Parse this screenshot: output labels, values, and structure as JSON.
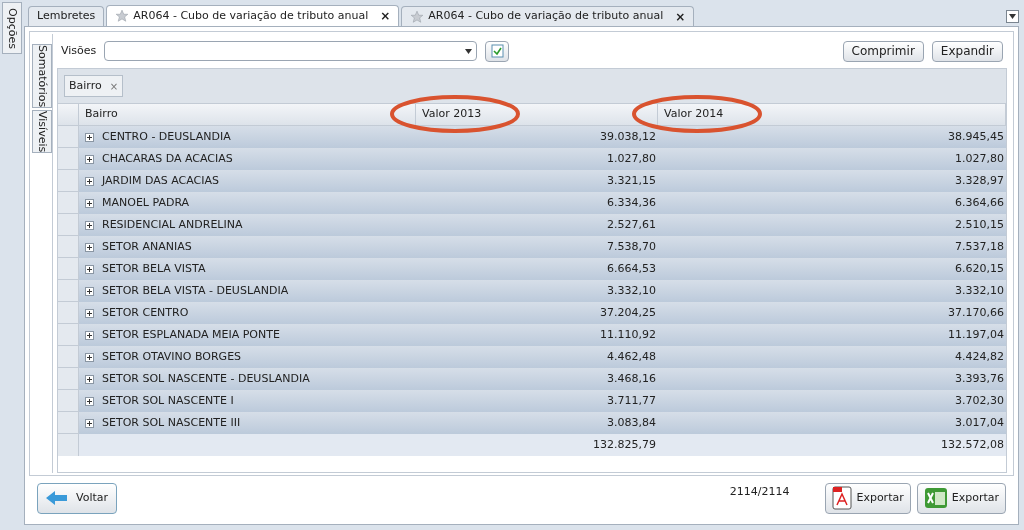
{
  "side_tab": "Opções",
  "tabs": [
    {
      "label": "Lembretes",
      "selected": false,
      "star": false,
      "closable": false
    },
    {
      "label": "AR064 - Cubo de variação de tributo anual",
      "selected": true,
      "star": true,
      "closable": true
    },
    {
      "label": "AR064 - Cubo de variação de tributo anual",
      "selected": false,
      "star": true,
      "closable": true
    }
  ],
  "close_glyph": "×",
  "vertical_tabs": [
    {
      "label": "Somatórios",
      "selected": false
    },
    {
      "label": "Visíveis",
      "selected": false
    }
  ],
  "visoes": {
    "label": "Visões"
  },
  "buttons": [
    "Comprimir",
    "Expandir"
  ],
  "group_chip": {
    "label": "Bairro",
    "remove": "×"
  },
  "table": {
    "columns": [
      {
        "label": "Bairro",
        "highlighted": false
      },
      {
        "label": "Valor 2013",
        "highlighted": true
      },
      {
        "label": "Valor 2014",
        "highlighted": true
      }
    ],
    "rows": [
      {
        "bairro": "CENTRO - DEUSLANDIA",
        "v2013": "39.038,12",
        "v2014": "38.945,45",
        "expanded": false
      },
      {
        "bairro": "CHACARAS DA ACACIAS",
        "v2013": "1.027,80",
        "v2014": "1.027,80",
        "expanded": false
      },
      {
        "bairro": "JARDIM DAS ACACIAS",
        "v2013": "3.321,15",
        "v2014": "3.328,97",
        "expanded": false
      },
      {
        "bairro": "MANOEL PADRA",
        "v2013": "6.334,36",
        "v2014": "6.364,66",
        "expanded": false
      },
      {
        "bairro": "RESIDENCIAL ANDRELINA",
        "v2013": "2.527,61",
        "v2014": "2.510,15",
        "expanded": false
      },
      {
        "bairro": "SETOR ANANIAS",
        "v2013": "7.538,70",
        "v2014": "7.537,18",
        "expanded": false
      },
      {
        "bairro": "SETOR BELA VISTA",
        "v2013": "6.664,53",
        "v2014": "6.620,15",
        "expanded": false
      },
      {
        "bairro": "SETOR BELA VISTA - DEUSLANDIA",
        "v2013": "3.332,10",
        "v2014": "3.332,10",
        "expanded": false
      },
      {
        "bairro": "SETOR CENTRO",
        "v2013": "37.204,25",
        "v2014": "37.170,66",
        "expanded": false
      },
      {
        "bairro": "SETOR ESPLANADA MEIA PONTE",
        "v2013": "11.110,92",
        "v2014": "11.197,04",
        "expanded": false
      },
      {
        "bairro": "SETOR OTAVINO BORGES",
        "v2013": "4.462,48",
        "v2014": "4.424,82",
        "expanded": false
      },
      {
        "bairro": "SETOR SOL NASCENTE - DEUSLANDIA",
        "v2013": "3.468,16",
        "v2014": "3.393,76",
        "expanded": false
      },
      {
        "bairro": "SETOR SOL NASCENTE I",
        "v2013": "3.711,77",
        "v2014": "3.702,30",
        "expanded": false
      },
      {
        "bairro": "SETOR SOL NASCENTE III",
        "v2013": "3.083,84",
        "v2014": "3.017,04",
        "expanded": false
      }
    ],
    "totals": [
      "132.825,79",
      "132.572,08"
    ]
  },
  "back_button": "Voltar",
  "record_count": "2114/2114",
  "export_buttons": [
    {
      "label": "Exportar",
      "kind": "pdf"
    },
    {
      "label": "Exportar",
      "kind": "excel"
    }
  ]
}
